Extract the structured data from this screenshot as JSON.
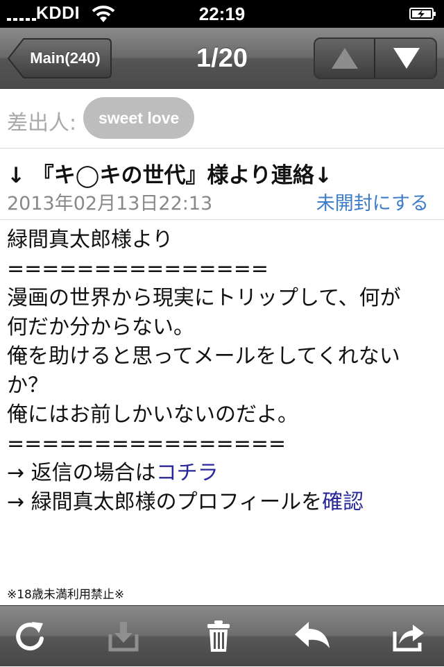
{
  "status_bar": {
    "carrier": "KDDI",
    "time": "22:19"
  },
  "nav": {
    "back_label": "Main(240)",
    "title": "1/20"
  },
  "sender": {
    "label": "差出人:",
    "name": "sweet love"
  },
  "message": {
    "subject": "↓ 『キ◯キの世代』様より連絡↓",
    "date": "2013年02月13日22:13",
    "mark_unread": "未開封にする",
    "body_lines": [
      "緑間真太郎様より",
      "===============",
      "漫画の世界から現実にトリップして、何が",
      "何だか分からない。",
      "俺を助けると思ってメールをしてくれない",
      "か？",
      "俺にはお前しかいないのだよ。",
      "================"
    ],
    "reply_prefix": "→ 返信の場合は",
    "reply_link": "コチラ",
    "profile_prefix": "→ 緑間真太郎様のプロフィールを",
    "profile_link": "確認",
    "footer_note": "※18歳未満利用禁止※"
  }
}
